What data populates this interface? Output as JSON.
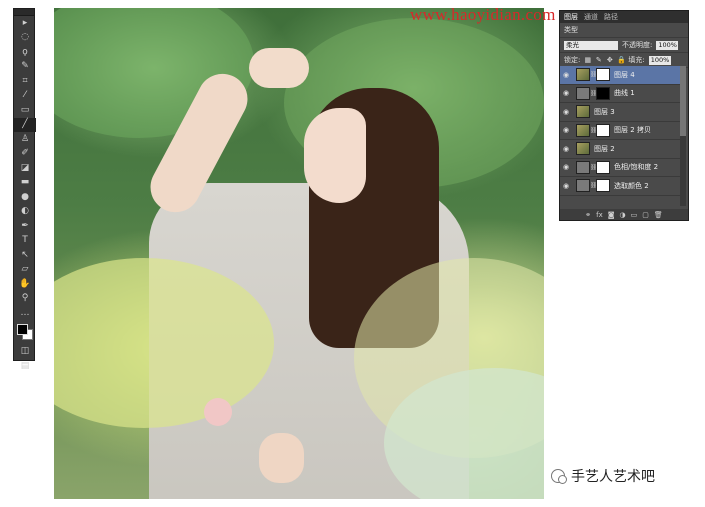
{
  "watermark": "www.haoyidian.com",
  "tools": [
    {
      "icon": "move-icon",
      "glyph": "▸"
    },
    {
      "icon": "marquee-icon",
      "glyph": "◌"
    },
    {
      "icon": "lasso-icon",
      "glyph": "ϙ"
    },
    {
      "icon": "quick-select-icon",
      "glyph": "✎"
    },
    {
      "icon": "crop-icon",
      "glyph": "⌗"
    },
    {
      "icon": "eyedropper-icon",
      "glyph": "⁄"
    },
    {
      "icon": "healing-brush-icon",
      "glyph": "▭"
    },
    {
      "icon": "brush-icon",
      "glyph": "╱",
      "active": true
    },
    {
      "icon": "clone-stamp-icon",
      "glyph": "♙"
    },
    {
      "icon": "history-brush-icon",
      "glyph": "✐"
    },
    {
      "icon": "eraser-icon",
      "glyph": "◪"
    },
    {
      "icon": "gradient-icon",
      "glyph": "▬"
    },
    {
      "icon": "blur-icon",
      "glyph": "●"
    },
    {
      "icon": "dodge-icon",
      "glyph": "◐"
    },
    {
      "icon": "pen-icon",
      "glyph": "✒"
    },
    {
      "icon": "type-icon",
      "glyph": "T"
    },
    {
      "icon": "path-select-icon",
      "glyph": "↖"
    },
    {
      "icon": "shape-icon",
      "glyph": "▱"
    },
    {
      "icon": "hand-icon",
      "glyph": "✋"
    },
    {
      "icon": "zoom-icon",
      "glyph": "⚲"
    },
    {
      "icon": "more-icon",
      "glyph": "…"
    }
  ],
  "tools_bottom": [
    {
      "icon": "quick-mask-icon",
      "glyph": "◫"
    },
    {
      "icon": "screen-mode-icon",
      "glyph": "▤"
    }
  ],
  "layers_panel": {
    "tabs": [
      "图层",
      "通道",
      "路径"
    ],
    "kind_label": "类型",
    "blend_mode": "柔光",
    "opacity_label": "不透明度:",
    "opacity": "100%",
    "lock_label": "锁定:",
    "fill_label": "填充:",
    "fill": "100%",
    "layers": [
      {
        "name": "图层 4",
        "selected": true,
        "thumb": "photo",
        "mask": "white"
      },
      {
        "name": "曲线 1",
        "selected": false,
        "thumb": "adj",
        "mask": "black"
      },
      {
        "name": "图层 3",
        "selected": false,
        "thumb": "photo",
        "mask": null
      },
      {
        "name": "图层 2 拷贝",
        "selected": false,
        "thumb": "photo",
        "mask": "white"
      },
      {
        "name": "图层 2",
        "selected": false,
        "thumb": "photo",
        "mask": null
      },
      {
        "name": "色相/饱和度 2",
        "selected": false,
        "thumb": "adj",
        "mask": "white"
      },
      {
        "name": "选取颜色 2",
        "selected": false,
        "thumb": "adj",
        "mask": "white"
      }
    ]
  },
  "brand": "手艺人艺术吧"
}
